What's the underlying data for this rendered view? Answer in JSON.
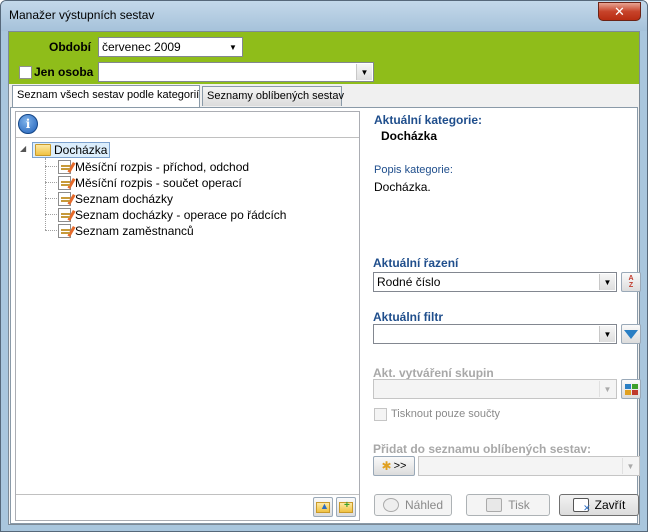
{
  "window": {
    "title": "Manažer výstupních sestav",
    "close_label": "✕"
  },
  "filters": {
    "period_label": "Období",
    "period_value": "červenec 2009",
    "person_label": "Jen osoba",
    "person_checked": false,
    "person_value": ""
  },
  "tabs": [
    {
      "label": "Seznam všech sestav podle kategorií",
      "active": true
    },
    {
      "label": "Seznamy oblíbených sestav",
      "active": false
    }
  ],
  "tree": {
    "root": {
      "label": "Docházka",
      "expanded": true,
      "selected": true
    },
    "children": [
      {
        "label": "Měsíční rozpis - příchod, odchod"
      },
      {
        "label": "Měsíční rozpis - součet operací"
      },
      {
        "label": "Seznam docházky"
      },
      {
        "label": "Seznam docházky - operace po řádcích"
      },
      {
        "label": "Seznam zaměstnanců"
      }
    ]
  },
  "details": {
    "current_category_label": "Aktuální kategorie:",
    "current_category_value": "Docházka",
    "description_label": "Popis kategorie:",
    "description_value": "Docházka.",
    "sort_label": "Aktuální řazení",
    "sort_value": "Rodné číslo",
    "filter_label": "Aktuální filtr",
    "filter_value": "",
    "grouping_label": "Akt. vytváření skupin",
    "grouping_value": "",
    "print_sums_label": "Tisknout pouze součty",
    "favorites_label": "Přidat do seznamu oblíbených sestav:",
    "favorites_add": ">>",
    "favorites_value": ""
  },
  "buttons": {
    "preview": "Náhled",
    "print": "Tisk",
    "close": "Zavřít"
  },
  "colors": {
    "accent_green": "#8fbd1a",
    "label_blue": "#1f4e8c"
  }
}
